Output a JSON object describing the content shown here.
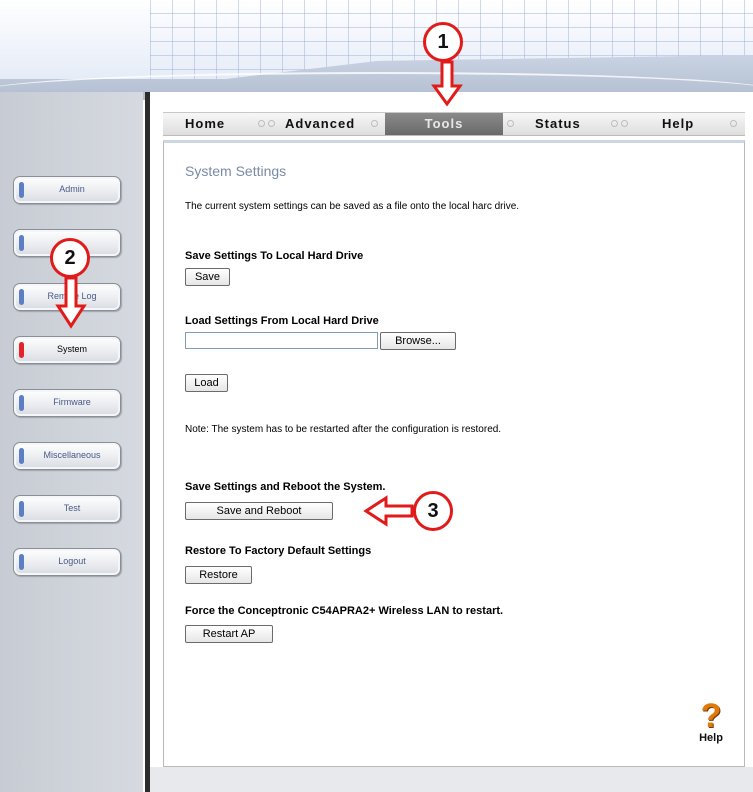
{
  "nav": {
    "tabs": [
      "Home",
      "Advanced",
      "Tools",
      "Status",
      "Help"
    ],
    "active_tab": "Tools"
  },
  "sidebar": {
    "items": [
      {
        "label": "Admin"
      },
      {
        "label": ""
      },
      {
        "label": "Remote Log"
      },
      {
        "label": "System"
      },
      {
        "label": "Firmware"
      },
      {
        "label": "Miscellaneous"
      },
      {
        "label": "Test"
      },
      {
        "label": "Logout"
      }
    ],
    "active_item": "System"
  },
  "content": {
    "title": "System Settings",
    "intro": "The current system settings can be saved as a file onto the local harc drive.",
    "save_heading": "Save Settings To Local Hard Drive",
    "save_button": "Save",
    "load_heading": "Load Settings From Local Hard Drive",
    "file_value": "",
    "browse_button": "Browse...",
    "load_button": "Load",
    "note": "Note: The system has to be restarted after the configuration is restored.",
    "reboot_heading": "Save Settings and Reboot the System.",
    "reboot_button": "Save and Reboot",
    "restore_heading": "Restore To Factory Default Settings",
    "restore_button": "Restore",
    "restart_heading": "Force the Conceptronic C54APRA2+ Wireless LAN to restart.",
    "restart_button": "Restart AP",
    "help_label": "Help"
  },
  "annotations": [
    "1",
    "2",
    "3"
  ],
  "colors": {
    "accent_red": "#e11a1a",
    "active_pill": "#e3242b",
    "pill": "#5b7fc2",
    "title": "#7a8aa6"
  }
}
